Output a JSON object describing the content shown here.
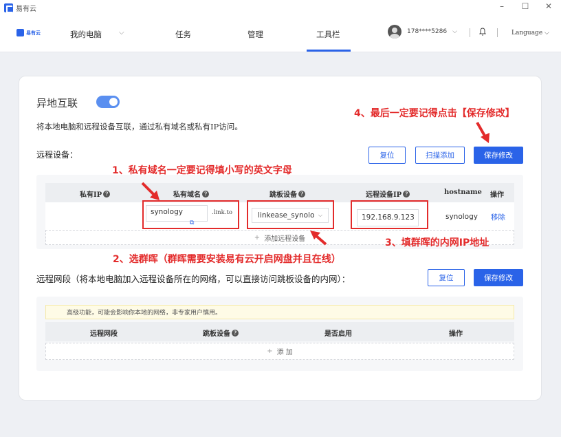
{
  "window": {
    "app_title": "易有云",
    "minimize": "–",
    "maximize": "☐",
    "close": "✕"
  },
  "nav": {
    "logo_text": "易有云",
    "items": [
      {
        "label": "我的电脑"
      },
      {
        "label": "任务"
      },
      {
        "label": "管理"
      },
      {
        "label": "工具栏"
      }
    ],
    "active": "工具栏",
    "user": "178****5286",
    "language": "Language"
  },
  "section": {
    "title": "异地互联",
    "toggle_on": true,
    "description": "将本地电脑和远程设备互联，通过私有域名或私有IP访问。"
  },
  "remote_devices": {
    "title": "远程设备：",
    "buttons": {
      "reset": "复位",
      "scan_add": "扫描添加",
      "save": "保存修改"
    },
    "columns": [
      "私有IP",
      "私有域名",
      "跳板设备",
      "远程设备IP",
      "hostname",
      "操作"
    ],
    "row": {
      "private_ip": "",
      "domain": "synology",
      "domain_suffix": ".link.to",
      "jump_device": "linkease_synolo",
      "remote_ip": "192.168.9.123",
      "hostname": "synology",
      "action": "移除"
    },
    "add_label": "添加远程设备"
  },
  "remote_subnet": {
    "title": "远程网段（将本地电脑加入远程设备所在的网络，可以直接访问跳板设备的内网）：",
    "buttons": {
      "reset": "复位",
      "save": "保存修改"
    },
    "warning": "高级功能，可能会影响你本地的网络，非专家用户慎用。",
    "columns": [
      "远程网段",
      "跳板设备",
      "是否启用",
      "操作"
    ],
    "add_label": "添 加"
  },
  "annotations": {
    "a1": "1、私有域名一定要记得填小写的英文字母",
    "a2": "2、选群晖（群晖需要安装易有云开启网盘并且在线）",
    "a3": "3、填群晖的内网IP地址",
    "a4": "4、最后一定要记得点击【保存修改】"
  },
  "colors": {
    "accent": "#2a63e8",
    "annotation": "#e32b2b"
  }
}
